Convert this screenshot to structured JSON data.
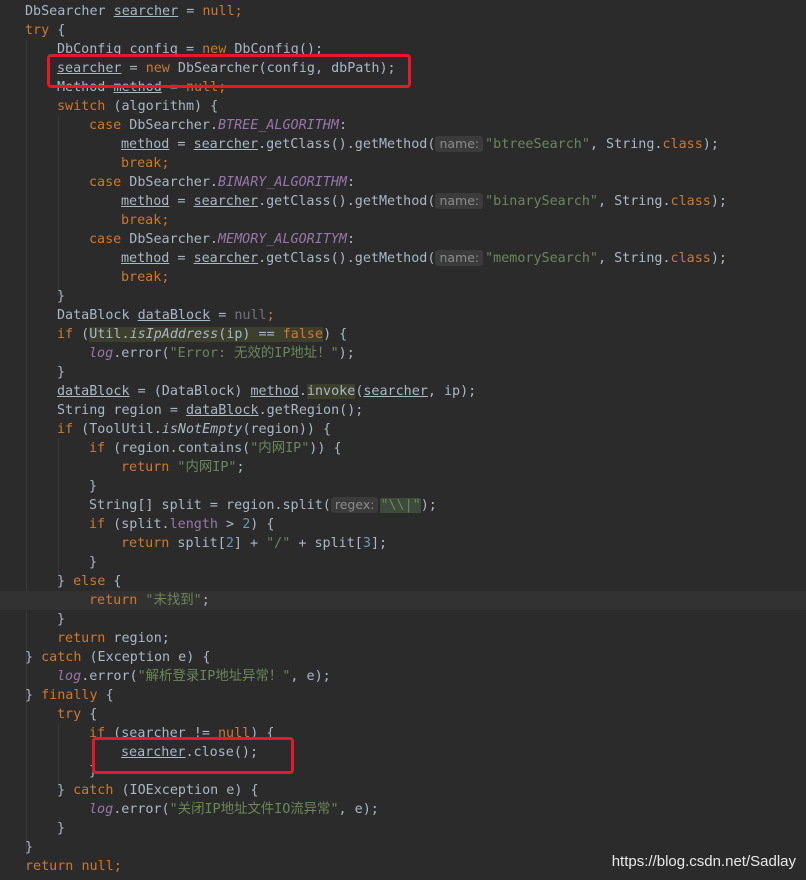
{
  "code": {
    "l1": {
      "t1": "DbSearcher ",
      "v1": "searcher",
      "t2": " = ",
      "k1": "null",
      "t3": ";"
    },
    "l2": {
      "k1": "try",
      "t1": " {"
    },
    "l3": {
      "t1": "DbConfig config = ",
      "k1": "new",
      "t2": " DbConfig();"
    },
    "l4": {
      "v1": "searcher",
      "t1": " = ",
      "k1": "new",
      "t2": " DbSearcher(config, dbPath);"
    },
    "l5": {
      "t1": "Method ",
      "v1": "method",
      "t2": " = ",
      "k1": "null",
      "t3": ";"
    },
    "l6": {
      "k1": "switch",
      "t1": " (algorithm) {"
    },
    "l7": {
      "k1": "case",
      "t1": " DbSearcher.",
      "f1": "BTREE_ALGORITHM",
      "t2": ":"
    },
    "l8": {
      "v1": "method",
      "t1": " = ",
      "v2": "searcher",
      "t2": ".getClass().getMethod(",
      "h1": "name:",
      "s1": "\"btreeSearch\"",
      "t3": ", String.",
      "k1": "class",
      "t4": ");"
    },
    "l9": {
      "k1": "break",
      "t1": ";"
    },
    "l10": {
      "k1": "case",
      "t1": " DbSearcher.",
      "f1": "BINARY_ALGORITHM",
      "t2": ":"
    },
    "l11": {
      "v1": "method",
      "t1": " = ",
      "v2": "searcher",
      "t2": ".getClass().getMethod(",
      "h1": "name:",
      "s1": "\"binarySearch\"",
      "t3": ", String.",
      "k1": "class",
      "t4": ");"
    },
    "l12": {
      "k1": "break",
      "t1": ";"
    },
    "l13": {
      "k1": "case",
      "t1": " DbSearcher.",
      "f1": "MEMORY_ALGORITYM",
      "t2": ":"
    },
    "l14": {
      "v1": "method",
      "t1": " = ",
      "v2": "searcher",
      "t2": ".getClass().getMethod(",
      "h1": "name:",
      "s1": "\"memorySearch\"",
      "t3": ", String.",
      "k1": "class",
      "t4": ");"
    },
    "l15": {
      "k1": "break",
      "t1": ";"
    },
    "l16": {
      "t1": "}"
    },
    "l17": {
      "t1": "DataBlock ",
      "v1": "dataBlock",
      "t2": " = ",
      "k1": "null",
      "t3": ";"
    },
    "l18": {
      "k1": "if",
      "t1": " (",
      "t2": "Util.",
      "m1": "isIpAddress",
      "t3": "(ip) == ",
      "k2": "false",
      "t4": ") {"
    },
    "l19": {
      "f1": "log",
      "t1": ".error(",
      "s1": "\"Error: 无效的IP地址！\"",
      "t2": ");"
    },
    "l20": {
      "t1": "}"
    },
    "l21": {
      "v1": "dataBlock",
      "t1": " = (DataBlock) ",
      "v2": "method",
      "t2": ".",
      "m1": "invoke",
      "t3": "(",
      "v3": "searcher",
      "t4": ", ip);"
    },
    "l22": {
      "t1": "String region = ",
      "v1": "dataBlock",
      "t2": ".getRegion();"
    },
    "l23": {
      "k1": "if",
      "t1": " (ToolUtil.",
      "m1": "isNotEmpty",
      "t2": "(region)) {"
    },
    "l24": {
      "k1": "if",
      "t1": " (region.contains(",
      "s1": "\"内网IP\"",
      "t2": ")) {"
    },
    "l25": {
      "k1": "return",
      "s1": " \"内网IP\"",
      "t1": ";"
    },
    "l26": {
      "t1": "}"
    },
    "l27": {
      "t1": "String[] split = region.split(",
      "h1": "regex:",
      "s1": "\"\\\\|\"",
      "t2": ");"
    },
    "l28": {
      "k1": "if",
      "t1": " (split.",
      "f1": "length",
      "t2": " > ",
      "n1": "2",
      "t3": ") {"
    },
    "l29": {
      "k1": "return",
      "t1": " split[",
      "n1": "2",
      "t2": "] + ",
      "s1": "\"/\"",
      "t3": " + split[",
      "n2": "3",
      "t4": "];"
    },
    "l30": {
      "t1": "}"
    },
    "l31": {
      "t1": "} ",
      "k1": "else",
      "t2": " {"
    },
    "l32": {
      "k1": "return",
      "s1": " \"未找到\"",
      "t1": ";"
    },
    "l33": {
      "t1": "}"
    },
    "l34": {
      "k1": "return",
      "t1": " region;"
    },
    "l35": {
      "t1": "} ",
      "k1": "catch",
      "t2": " (Exception e) {"
    },
    "l36": {
      "f1": "log",
      "t1": ".error(",
      "s1": "\"解析登录IP地址异常！\"",
      "t2": ", e);"
    },
    "l37": {
      "t1": "} ",
      "k1": "finally",
      "t2": " {"
    },
    "l38": {
      "k1": "try",
      "t1": " {"
    },
    "l39": {
      "k1": "if",
      "t1": " (",
      "v1": "searcher",
      "t2": " != ",
      "k2": "null",
      "t3": ") {"
    },
    "l40": {
      "v1": "searcher",
      "t1": ".close();"
    },
    "l41": {
      "t1": "}"
    },
    "l42": {
      "t1": "} ",
      "k1": "catch",
      "t2": " (IOException e) {"
    },
    "l43": {
      "f1": "log",
      "t1": ".error(",
      "s1": "\"关闭IP地址文件IO流异常\"",
      "t2": ", e);"
    },
    "l44": {
      "t1": "}"
    },
    "l45": {
      "t1": "}"
    },
    "l46": {
      "k1": "return",
      "t1": " ",
      "k2": "null",
      "t2": ";"
    }
  },
  "watermark": "https://blog.csdn.net/Sadlay",
  "colors": {
    "background": "#2b2b2b",
    "keyword": "#cc7832",
    "string": "#6a8759",
    "number": "#6897bb",
    "field": "#9876aa",
    "text": "#a9b7c6",
    "highlight_box": "#e5192a"
  }
}
